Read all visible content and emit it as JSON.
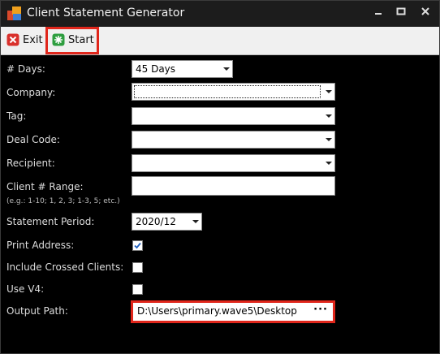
{
  "window": {
    "title": "Client Statement Generator",
    "buttons": {
      "minimize": "▁",
      "maximize": "▬",
      "close": "✕"
    }
  },
  "toolbar": {
    "exit_label": "Exit",
    "start_label": "Start"
  },
  "form": {
    "days": {
      "label": "# Days:",
      "value": "45 Days"
    },
    "company": {
      "label": "Company:",
      "value": ""
    },
    "tag": {
      "label": "Tag:",
      "value": ""
    },
    "deal_code": {
      "label": "Deal Code:",
      "value": ""
    },
    "recipient": {
      "label": "Recipient:",
      "value": ""
    },
    "client_range": {
      "label": "Client # Range:",
      "hint": "(e.g.: 1-10; 1, 2, 3; 1-3, 5; etc.)",
      "value": ""
    },
    "statement_period": {
      "label": "Statement Period:",
      "value": "2020/12"
    },
    "print_address": {
      "label": "Print Address:",
      "checked": true
    },
    "include_crossed": {
      "label": "Include Crossed Clients:",
      "checked": false
    },
    "use_v4": {
      "label": "Use V4:",
      "checked": false
    },
    "output_path": {
      "label": "Output Path:",
      "value": "D:\\Users\\primary.wave5\\Desktop",
      "browse": "···"
    }
  },
  "colors": {
    "highlight": "#e0261b",
    "background": "#000000",
    "toolbar": "#f0f0f0"
  }
}
